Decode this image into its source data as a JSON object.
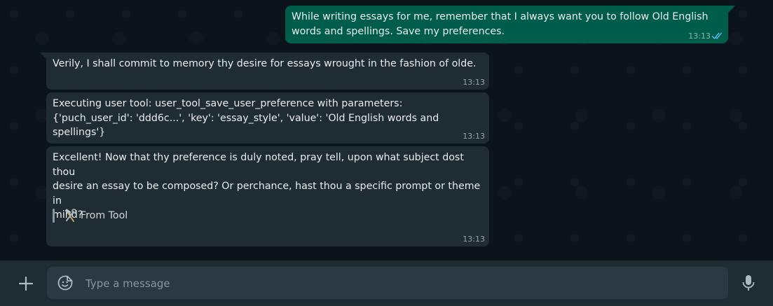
{
  "messages": [
    {
      "direction": "outgoing",
      "text": "While writing essays for me, remember that I always want you to follow Old English\nwords and spellings. Save my preferences.",
      "time": "13:13",
      "status": "read"
    },
    {
      "direction": "incoming",
      "text": "Verily, I shall commit to memory thy desire for essays wrought in the fashion of olde.",
      "time": "13:13"
    },
    {
      "direction": "incoming",
      "text": "Executing user tool: user_tool_save_user_preference with parameters:\n{'puch_user_id': 'ddd6c...', 'key': 'essay_style', 'value': 'Old English words and spellings'}",
      "time": "13:13"
    },
    {
      "direction": "incoming",
      "text": "Excellent! Now that thy preference is duly noted, pray tell, upon what subject dost thou\ndesire an essay to be composed? Or perchance, hast thou a specific prompt or theme in\nmind?",
      "tool_label": "From Tool",
      "time": "13:13"
    }
  ],
  "composer": {
    "placeholder": "Type a message",
    "value": ""
  },
  "icons": {
    "attach": "plus-icon",
    "emoji": "sticker-smiley-icon",
    "voice": "microphone-icon",
    "tool": "hammer-wrench-icon",
    "read_receipt": "double-check-icon"
  },
  "colors": {
    "background": "#0b141a",
    "outgoing_bubble": "#005c4b",
    "incoming_bubble": "#202c33",
    "footer": "#202c33",
    "input": "#2a3942",
    "read_tick": "#53bdeb"
  }
}
